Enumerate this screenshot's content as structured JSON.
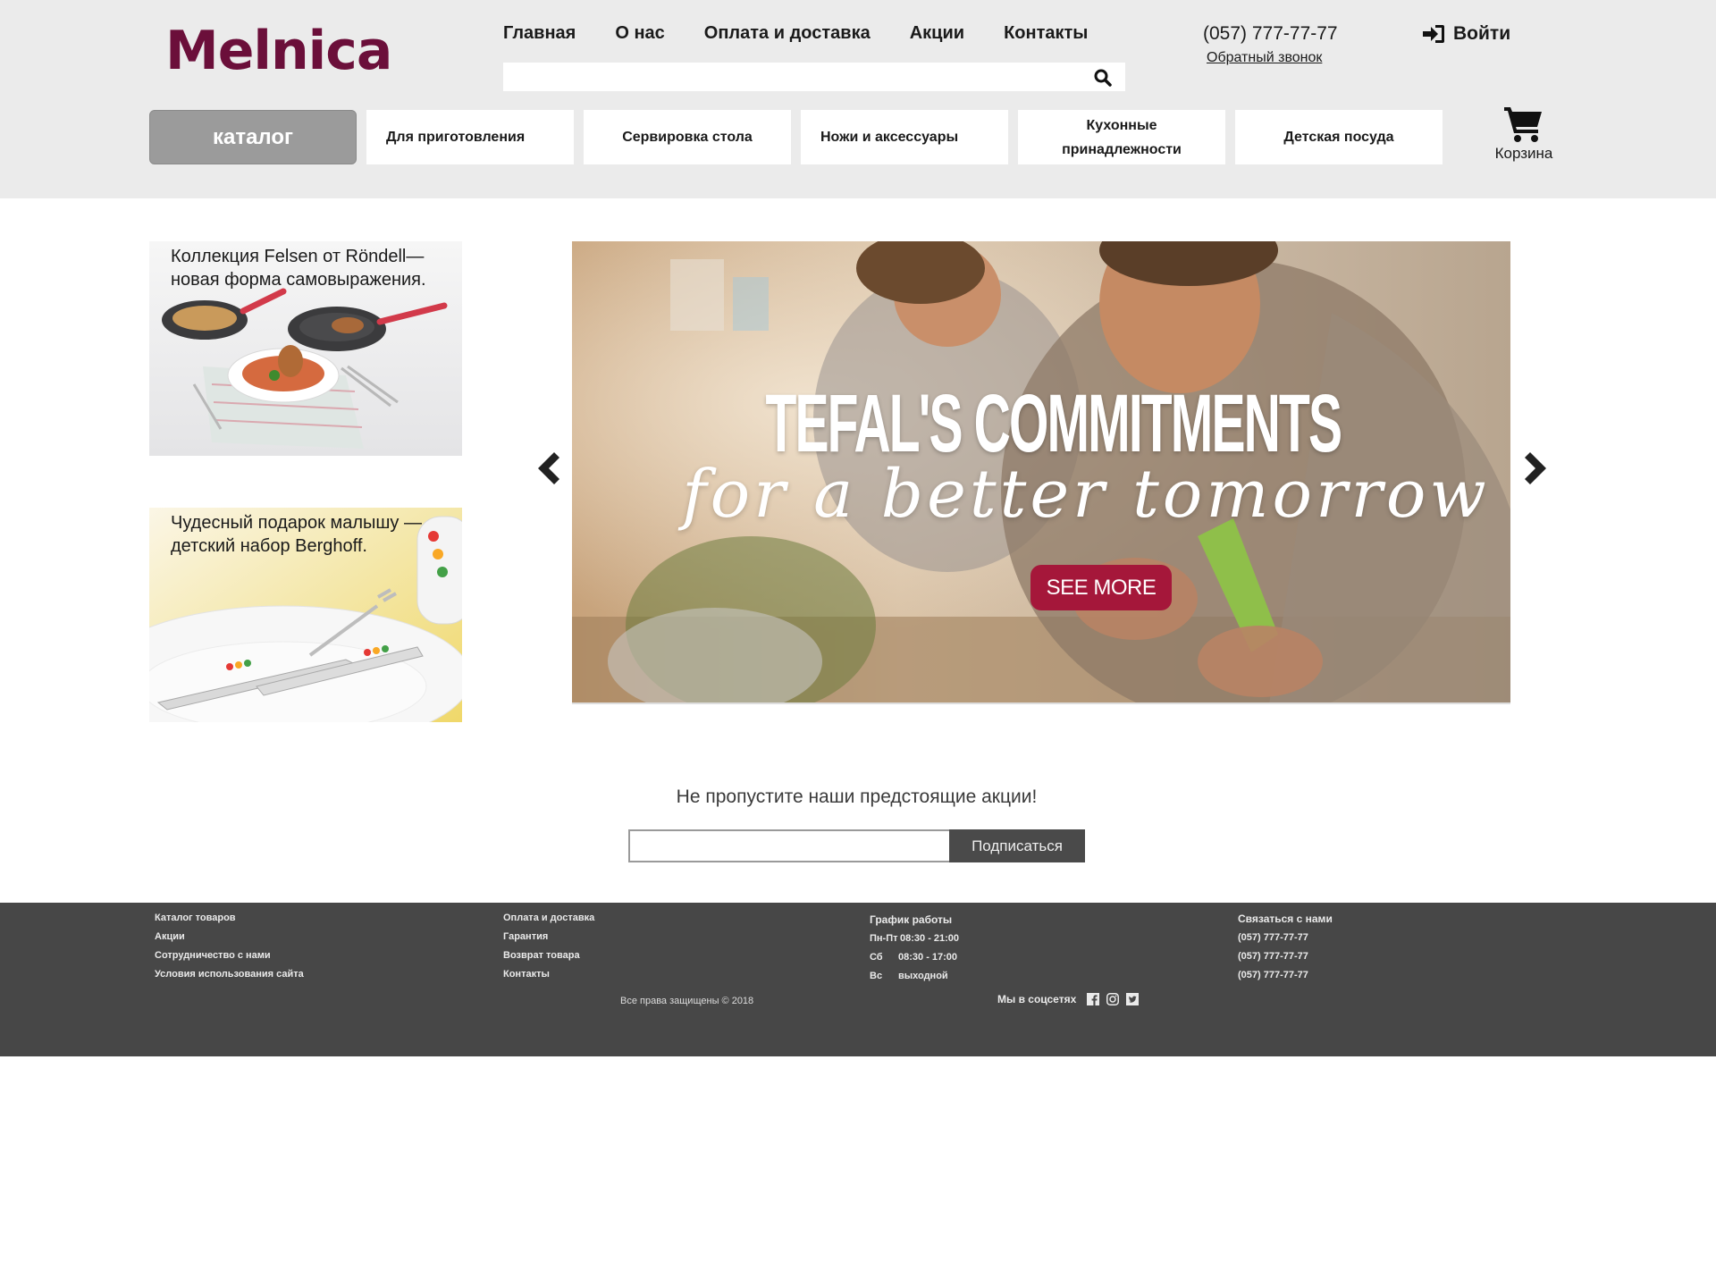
{
  "header": {
    "logo": "Melnica",
    "nav": [
      "Главная",
      "О нас",
      "Оплата и доставка",
      "Акции",
      "Контакты"
    ],
    "search": {
      "placeholder": "",
      "icon": "search-icon"
    },
    "phone": "(057) 777-77-77",
    "callback": "Обратный звонок",
    "login": "Войти",
    "catalog_button": "каталог",
    "categories": [
      "Для приготовления",
      "Сервировка стола",
      "Ножи и аксессуары",
      "Кухонные принадлежности",
      "Детская посуда"
    ],
    "cart": "Корзина"
  },
  "promos": [
    {
      "text": "Коллекция Felsen от Röndell— новая форма самовыражения."
    },
    {
      "text": "Чудесный подарок малышу — детский набор Berghoff."
    }
  ],
  "slider": {
    "title": "TEFAL'S COMMITMENTS",
    "subtitle": "for a better tomorrow",
    "button": "SEE MORE",
    "accent": "#a5173a"
  },
  "subscribe": {
    "title": "Не пропустите наши предстоящие акции!",
    "input_placeholder": "",
    "button": "Подписаться"
  },
  "footer": {
    "col1": [
      "Каталог товаров",
      "Акции",
      "Сотрудничество с нами",
      "Условия использования сайта"
    ],
    "col2": [
      "Оплата и доставка",
      "Гарантия",
      "Возврат товара",
      "Контакты"
    ],
    "schedule": {
      "title": "График работы",
      "rows": [
        {
          "day": "Пн-Пт",
          "hours": "08:30 - 21:00"
        },
        {
          "day": "Сб",
          "hours": "08:30 - 17:00"
        },
        {
          "day": "Вс",
          "hours": "выходной"
        }
      ]
    },
    "contact": {
      "title": "Связаться с нами",
      "phones": [
        "(057) 777-77-77",
        "(057) 777-77-77",
        "(057) 777-77-77"
      ]
    },
    "copyright": "Все права защищены © 2018",
    "social_label": "Мы в соцсетях",
    "social_icons": [
      "facebook-icon",
      "instagram-icon",
      "twitter-icon"
    ]
  },
  "colors": {
    "brand": "#6b0f3a",
    "header_bg": "#ebebeb",
    "footer_bg": "#474747",
    "catalog_btn": "#9b9b9b"
  }
}
